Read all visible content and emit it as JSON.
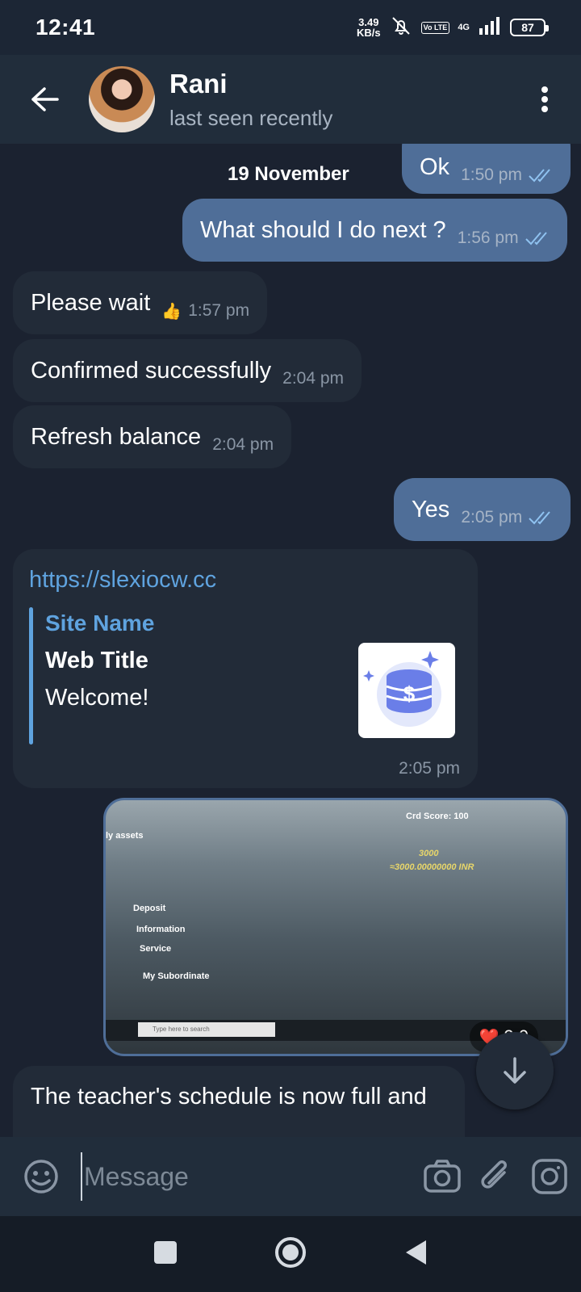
{
  "status_bar": {
    "time": "12:41",
    "speed_value": "3.49",
    "speed_unit": "KB/s",
    "volte": "Vo LTE",
    "network": "4G",
    "battery": "87"
  },
  "header": {
    "contact_name": "Rani",
    "contact_status": "last seen recently"
  },
  "chat": {
    "date_label": "19 November",
    "messages": [
      {
        "text": "Ok",
        "time": "1:50 pm",
        "dir": "out"
      },
      {
        "text": "What should I do next ?",
        "time": "1:56 pm",
        "dir": "out"
      },
      {
        "text": "Please wait",
        "time": "1:57 pm",
        "dir": "in",
        "reaction": "👍"
      },
      {
        "text": "Confirmed successfully",
        "time": "2:04 pm",
        "dir": "in"
      },
      {
        "text": "Refresh balance",
        "time": "2:04 pm",
        "dir": "in"
      },
      {
        "text": "Yes",
        "time": "2:05 pm",
        "dir": "out"
      },
      {
        "text": "The teacher's schedule is now full and",
        "dir": "in"
      }
    ],
    "link_message": {
      "url": "https://slexiocw.cc",
      "site_name": "Site Name",
      "title": "Web Title",
      "description": "Welcome!",
      "time": "2:05 pm"
    },
    "photo_message": {
      "time": "2:0",
      "reaction": "❤️",
      "photo_texts": {
        "credit": "Crd Score: 100",
        "assets": "ly assets",
        "amount": "3000",
        "amount_inr": "≈3000.00000000 INR",
        "deposit": "Deposit",
        "information": "Information",
        "service": "Service",
        "subordinate": "My Subordinate",
        "search": "Type here to search"
      }
    }
  },
  "input": {
    "placeholder": "Message"
  },
  "colors": {
    "background": "#1b2230",
    "header": "#212d3b",
    "outgoing_bubble": "#4f6e98",
    "incoming_bubble": "#222b38",
    "link": "#5fa3df"
  }
}
